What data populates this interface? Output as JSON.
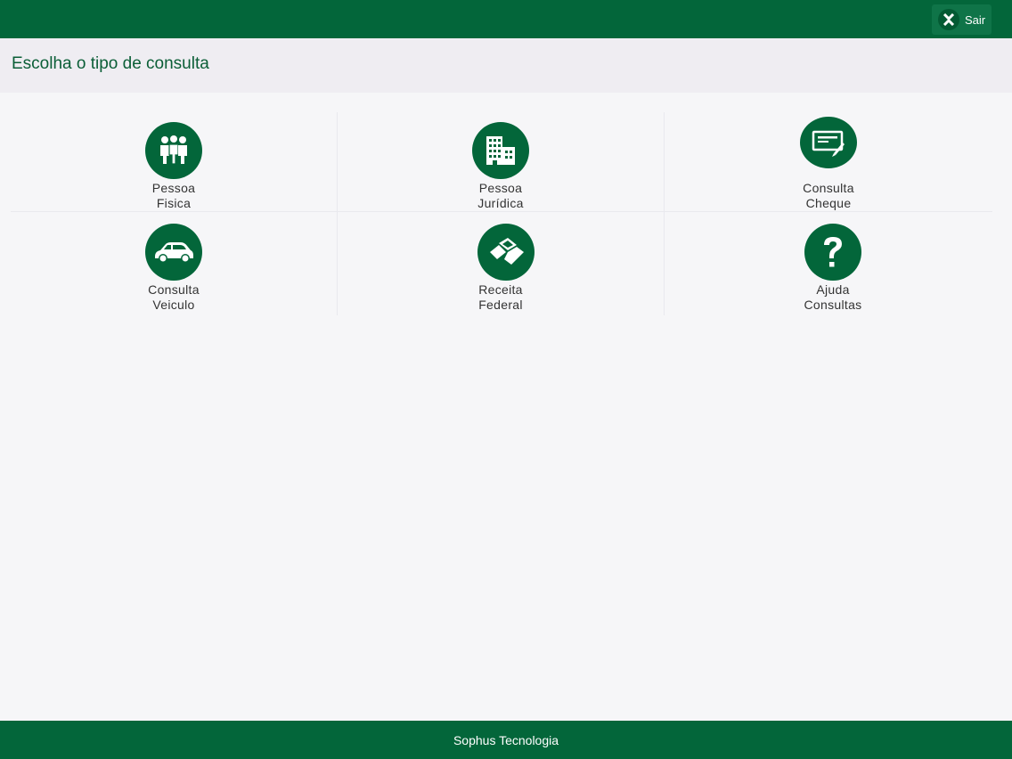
{
  "header": {
    "exit_label": "Sair",
    "exit_icon": "close-x-icon"
  },
  "subheader": {
    "title": "Escolha o tipo de consulta"
  },
  "tiles": [
    {
      "label": "Pessoa\nFisica",
      "icon": "people-group-icon"
    },
    {
      "label": "Pessoa\nJurídica",
      "icon": "buildings-icon"
    },
    {
      "label": "Consulta\nCheque",
      "icon": "check-document-icon"
    },
    {
      "label": "Consulta\nVeiculo",
      "icon": "car-icon"
    },
    {
      "label": "Receita\nFederal",
      "icon": "receita-federal-logo-icon"
    },
    {
      "label": "Ajuda\nConsultas",
      "icon": "question-mark-icon"
    }
  ],
  "footer": {
    "text": "Sophus Tecnologia"
  },
  "colors": {
    "primary_green": "#03663a",
    "title_green": "#0b5e37",
    "background": "#f6f6f8"
  }
}
